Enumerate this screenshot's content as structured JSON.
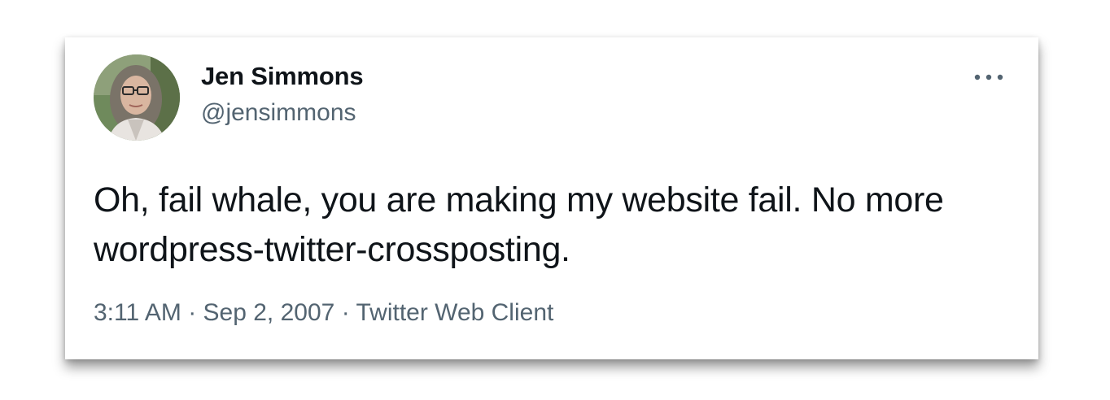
{
  "tweet": {
    "author_name": "Jen Simmons",
    "author_handle": "@jensimmons",
    "text": "Oh, fail whale, you are making my website fail. No more wordpress-twitter-crossposting.",
    "time": "3:11 AM",
    "date": "Sep 2, 2007",
    "source": "Twitter Web Client",
    "separator": "·",
    "more_icon": "more-horizontal-icon"
  },
  "colors": {
    "primary_text": "#0f1419",
    "secondary_text": "#536471",
    "background": "#ffffff"
  }
}
